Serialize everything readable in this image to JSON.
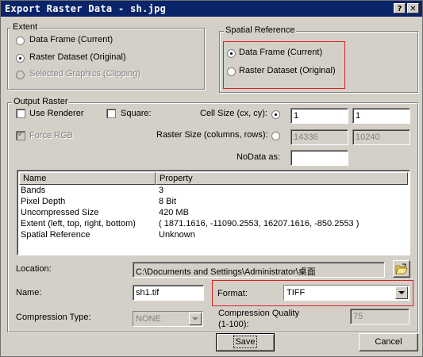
{
  "window": {
    "title": "Export Raster Data - sh.jpg",
    "help_button": "?",
    "close_button": "✕"
  },
  "extent": {
    "label": "Extent",
    "options": [
      {
        "label": "Data Frame (Current)",
        "selected": false,
        "enabled": true
      },
      {
        "label": "Raster Dataset (Original)",
        "selected": true,
        "enabled": true
      },
      {
        "label": "Selected Graphics (Clipping)",
        "selected": false,
        "enabled": false
      }
    ]
  },
  "spatial_reference": {
    "label": "Spatial Reference",
    "options": [
      {
        "label": "Data Frame (Current)",
        "selected": true
      },
      {
        "label": "Raster Dataset (Original)",
        "selected": false
      }
    ]
  },
  "output_raster": {
    "label": "Output Raster",
    "use_renderer_label": "Use Renderer",
    "square_label": "Square:",
    "force_rgb_label": "Force RGB",
    "cell_size_label": "Cell Size (cx, cy):",
    "cell_size_x": "1",
    "cell_size_y": "1",
    "raster_size_label": "Raster Size (columns, rows):",
    "raster_cols": "14336",
    "raster_rows": "10240",
    "nodata_label": "NoData as:",
    "nodata_value": ""
  },
  "properties": {
    "columns": [
      "Name",
      "Property"
    ],
    "rows": [
      {
        "name": "Bands",
        "value": "3"
      },
      {
        "name": "Pixel Depth",
        "value": "8 Bit"
      },
      {
        "name": "Uncompressed Size",
        "value": "420 MB"
      },
      {
        "name": "Extent (left, top, right, bottom)",
        "value": "( 1871.1616, -11090.2553, 16207.1616, -850.2553 )"
      },
      {
        "name": "Spatial Reference",
        "value": "Unknown"
      }
    ]
  },
  "location": {
    "label": "Location:",
    "value": "C:\\Documents and Settings\\Administrator\\桌面"
  },
  "name": {
    "label": "Name:",
    "value": "sh1.tif"
  },
  "format": {
    "label": "Format:",
    "value": "TIFF"
  },
  "compression": {
    "type_label": "Compression Type:",
    "type_value": "NONE",
    "quality_label_1": "Compression Quality",
    "quality_label_2": "(1-100):",
    "quality_value": "75"
  },
  "buttons": {
    "save": "Save",
    "cancel": "Cancel"
  }
}
